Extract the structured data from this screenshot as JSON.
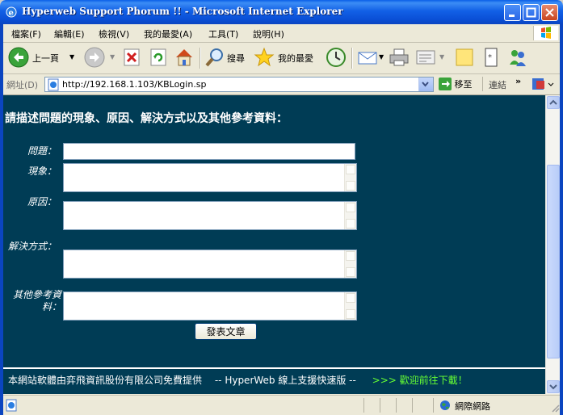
{
  "window": {
    "title": "Hyperweb Support Phorum !! - Microsoft Internet Explorer"
  },
  "menu": {
    "items": [
      "檔案(F)",
      "編輯(E)",
      "檢視(V)",
      "我的最愛(A)",
      "工具(T)",
      "說明(H)"
    ]
  },
  "toolbar": {
    "back": "上一頁",
    "search": "搜尋",
    "favorites": "我的最愛"
  },
  "address": {
    "label": "網址(D)",
    "url": "http://192.168.1.103/KBLogin.sp",
    "go": "移至",
    "links": "連結"
  },
  "form": {
    "heading": "請描述問題的現象、原因、解決方式以及其他參考資料：",
    "problem_label": "問題：",
    "symptom_label": "現象：",
    "cause_label": "原因：",
    "solution_label": "解決方式：",
    "other_label": "其他參考資料：",
    "submit_label": "發表文章"
  },
  "footer": {
    "provider": "本網站軟體由弈飛資訊股份有限公司免費提供",
    "product": "-- HyperWeb 線上支援快速版 --",
    "download": ">>> 歡迎前往下載！"
  },
  "status": {
    "zone": "網際網路"
  }
}
